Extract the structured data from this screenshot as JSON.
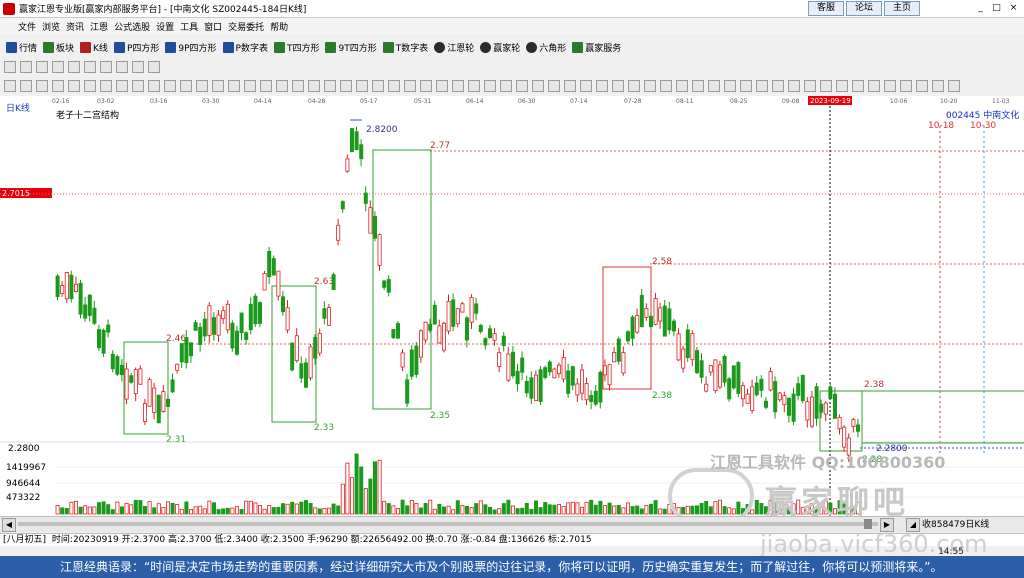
{
  "window": {
    "title": "赢家江恩专业版[赢家内部服务平台] - [中南文化  SZ002445-184日K线]",
    "links": [
      "客服",
      "论坛",
      "主页"
    ],
    "controls": [
      "_",
      "□",
      "×"
    ]
  },
  "menu": [
    "文件",
    "浏览",
    "资讯",
    "江恩",
    "公式选股",
    "设置",
    "工具",
    "窗口",
    "交易委托",
    "帮助"
  ],
  "toolbar1": [
    {
      "label": "行情",
      "icon": "grid-icon"
    },
    {
      "label": "板块",
      "icon": "blocks-icon"
    },
    {
      "label": "K线",
      "icon": "candle-icon"
    },
    {
      "label": "P四方形",
      "icon": "p-square-icon"
    },
    {
      "label": "9P四方形",
      "icon": "9p-square-icon"
    },
    {
      "label": "P数字表",
      "icon": "p-table-icon"
    },
    {
      "label": "T四方形",
      "icon": "t-square-icon"
    },
    {
      "label": "9T四方形",
      "icon": "9t-square-icon"
    },
    {
      "label": "T数字表",
      "icon": "t-table-icon"
    },
    {
      "label": "江恩轮",
      "icon": "gann-wheel-icon"
    },
    {
      "label": "赢家轮",
      "icon": "winner-wheel-icon"
    },
    {
      "label": "六角形",
      "icon": "hexagon-icon"
    },
    {
      "label": "赢家服务",
      "icon": "dollar-icon"
    }
  ],
  "chart_header": {
    "period": "日K线",
    "indicator": "老子十二宫结构",
    "stock": "002445   中南文化",
    "price_marker": "2.7015",
    "date_cursor": "2023-09-19"
  },
  "date_axis": [
    "02-16",
    "03-02",
    "03-16",
    "03-30",
    "04-14",
    "04-28",
    "05-17",
    "05-31",
    "06-14",
    "06-30",
    "07-14",
    "07-28",
    "08-11",
    "08-25",
    "09-08",
    "2023-09-19",
    "10-06",
    "10-20",
    "11-03"
  ],
  "time_markers": [
    "10-18",
    "10-30"
  ],
  "volume_axis": [
    "1419967",
    "946644",
    "473322"
  ],
  "price_axis_low": "2.2800",
  "chart_data": {
    "type": "candlestick",
    "title": "老子十二宫结构",
    "annotations": [
      {
        "label": "2.8200",
        "kind": "high"
      },
      {
        "label": "2.77",
        "kind": "box-top"
      },
      {
        "label": "2.58",
        "kind": "box-top"
      },
      {
        "label": "2.63",
        "kind": "level"
      },
      {
        "label": "2.46",
        "kind": "level"
      },
      {
        "label": "2.38",
        "kind": "box-top"
      },
      {
        "label": "2.38",
        "kind": "box-top"
      },
      {
        "label": "2.35",
        "kind": "box-bottom"
      },
      {
        "label": "2.33",
        "kind": "box-bottom"
      },
      {
        "label": "2.31",
        "kind": "box-bottom"
      },
      {
        "label": "2.2800",
        "kind": "low"
      },
      {
        "label": "2.28",
        "kind": "box-bottom"
      }
    ],
    "ylim": [
      2.25,
      2.85
    ]
  },
  "status": {
    "lunar": "[八月初五]",
    "text": "时间:20230919 开:2.3700 高:2.3700 低:2.3400 收:2.3500 手:96290 额:22656492.00 换:0.70 涨:-0.84 盘:136626 标:2.7015"
  },
  "volume_info": "收858479日K线",
  "watermark": {
    "line1": "江恩工具软件  QQ:100800360",
    "line2": "赢家聊吧",
    "line3": "jiaoba.vicf360.com"
  },
  "clock": "14:55",
  "quote": "江恩经典语录：“时间是决定市场走势的重要因素，经过详细研究大市及个别股票的过往记录，你将可以证明，历史确实重复发生；而了解过往，你将可以预测将来。”。"
}
